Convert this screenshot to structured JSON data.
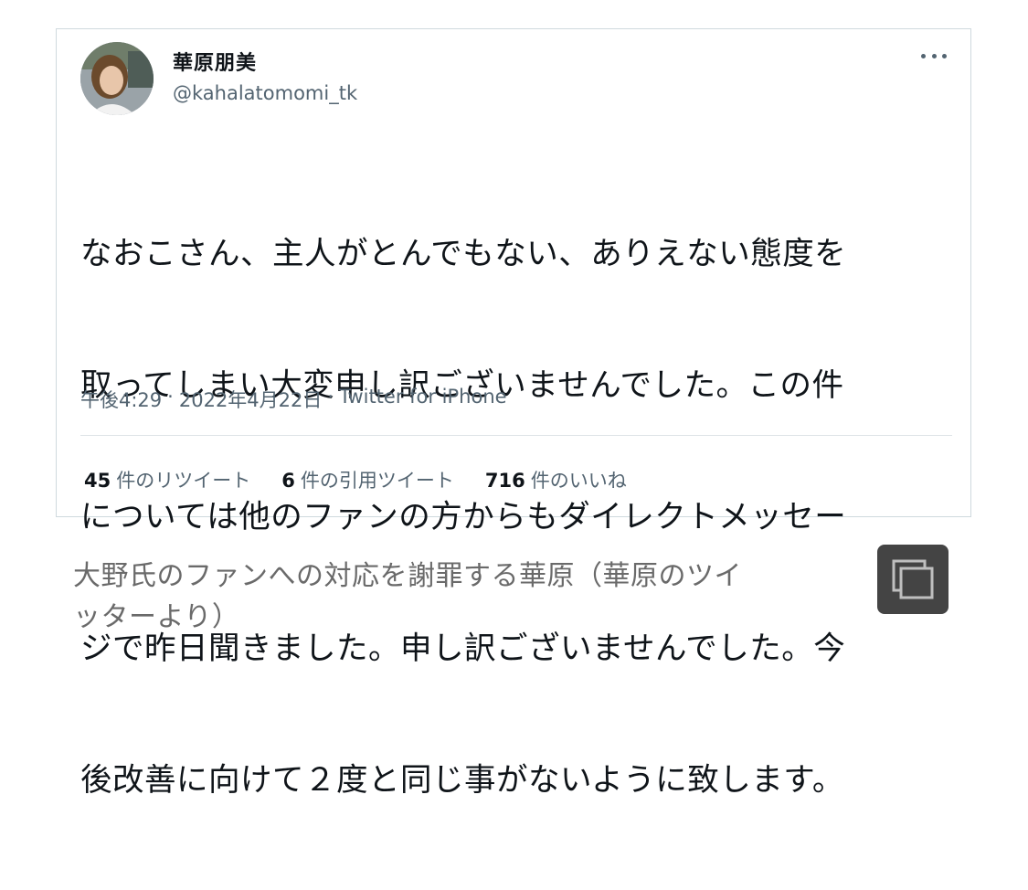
{
  "tweet": {
    "author": {
      "display_name": "華原朋美",
      "handle": "@kahalatomomi_tk"
    },
    "text_lines": [
      "なおこさん、主人がとんでもない、ありえない態度を",
      "取ってしまい大変申し訳ございませんでした。この件",
      "については他のファンの方からもダイレクトメッセー",
      "ジで昨日聞きました。申し訳ございませんでした。今",
      "後改善に向けて２度と同じ事がないように致します。"
    ],
    "meta": {
      "time": "午後4:29",
      "separator": "·",
      "date": "2022年4月22日",
      "source": "Twitter for iPhone"
    },
    "stats": {
      "retweets": {
        "count": "45",
        "label": "件のリツイート"
      },
      "quotes": {
        "count": "6",
        "label": "件の引用ツイート"
      },
      "likes": {
        "count": "716",
        "label": "件のいいね"
      }
    },
    "more_icon": "more-horizontal-icon"
  },
  "caption": {
    "lines": [
      "大野氏のファンへの対応を謝罪する華原（華原のツイ",
      "ッターより）"
    ]
  },
  "copy_icon": "copy-icon",
  "colors": {
    "text_primary": "#0f1419",
    "text_secondary": "#536471",
    "border": "#cfd9de",
    "caption": "#6a6a6a",
    "copy_button_bg": "#444444"
  }
}
